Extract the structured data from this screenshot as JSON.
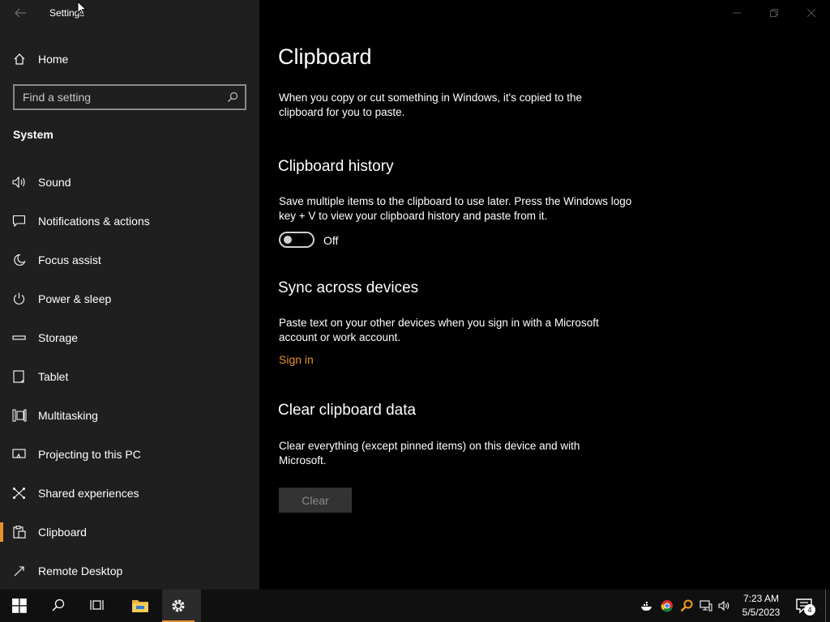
{
  "window": {
    "title": "Settings"
  },
  "sidebar": {
    "home_label": "Home",
    "search_placeholder": "Find a setting",
    "section_title": "System",
    "items": [
      {
        "label": "Sound",
        "icon": "speaker-icon"
      },
      {
        "label": "Notifications & actions",
        "icon": "message-icon"
      },
      {
        "label": "Focus assist",
        "icon": "moon-icon"
      },
      {
        "label": "Power & sleep",
        "icon": "power-icon"
      },
      {
        "label": "Storage",
        "icon": "storage-drive-icon"
      },
      {
        "label": "Tablet",
        "icon": "tablet-icon"
      },
      {
        "label": "Multitasking",
        "icon": "multitasking-icon"
      },
      {
        "label": "Projecting to this PC",
        "icon": "projector-icon"
      },
      {
        "label": "Shared experiences",
        "icon": "shared-experiences-icon"
      },
      {
        "label": "Clipboard",
        "icon": "clipboard-icon",
        "active": true
      },
      {
        "label": "Remote Desktop",
        "icon": "remote-desktop-icon"
      }
    ]
  },
  "main": {
    "title": "Clipboard",
    "intro": "When you copy or cut something in Windows, it's copied to the clipboard for you to paste.",
    "history": {
      "heading": "Clipboard history",
      "description": "Save multiple items to the clipboard to use later. Press the Windows logo key + V to view your clipboard history and paste from it.",
      "toggle_state": "Off"
    },
    "sync": {
      "heading": "Sync across devices",
      "description": "Paste text on your other devices when you sign in with a Microsoft account or work account.",
      "link": "Sign in"
    },
    "clear": {
      "heading": "Clear clipboard data",
      "description": "Clear everything (except pinned items) on this device and with Microsoft.",
      "button": "Clear"
    }
  },
  "taskbar": {
    "time": "7:23 AM",
    "date": "5/5/2023",
    "notification_count": "4"
  },
  "colors": {
    "accent": "#e8912d",
    "sidebar_bg": "#1f1f1f",
    "main_bg": "#000000"
  }
}
